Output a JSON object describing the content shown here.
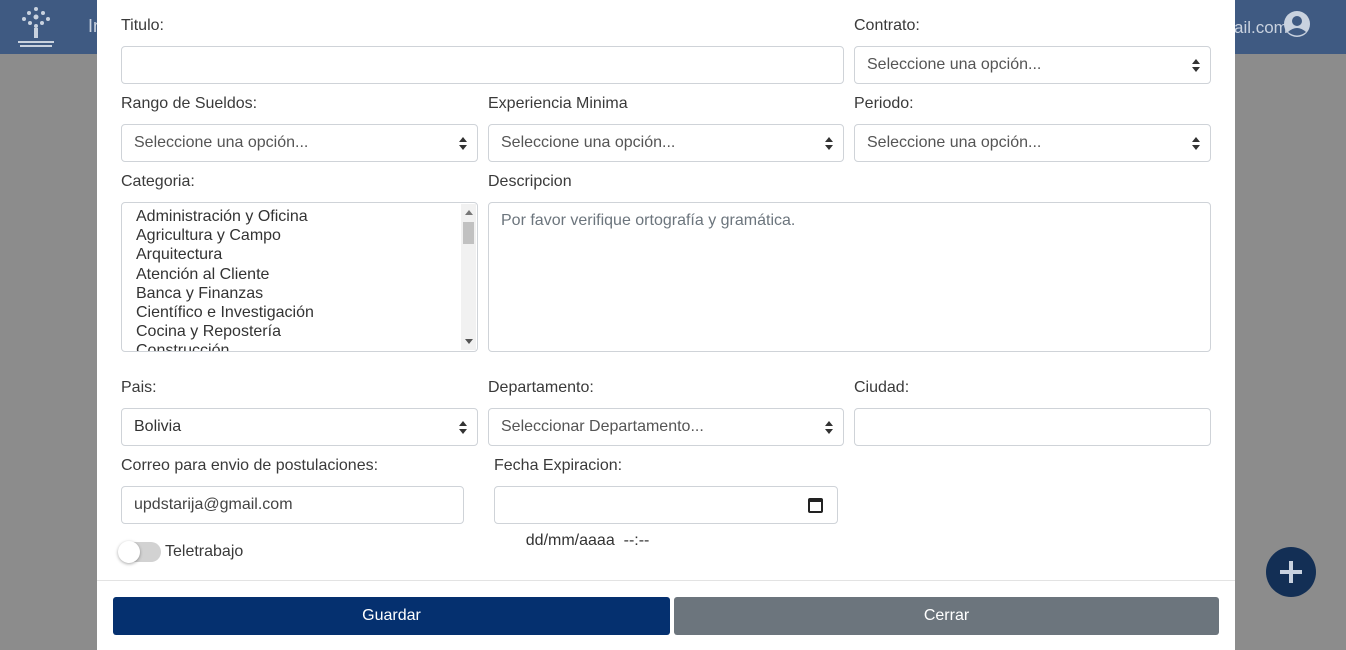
{
  "background": {
    "title_fragment": "In",
    "email_fragment": "ail.com"
  },
  "form": {
    "titulo": {
      "label": "Titulo:",
      "value": ""
    },
    "contrato": {
      "label": "Contrato:",
      "value": "Seleccione una opción..."
    },
    "rango_sueldos": {
      "label": "Rango de Sueldos:",
      "value": "Seleccione una opción..."
    },
    "experiencia": {
      "label": "Experiencia Minima",
      "value": "Seleccione una opción..."
    },
    "periodo": {
      "label": "Periodo:",
      "value": "Seleccione una opción..."
    },
    "categoria": {
      "label": "Categoria:",
      "options": [
        "Administración y Oficina",
        "Agricultura y Campo",
        "Arquitectura",
        "Atención al Cliente",
        "Banca y Finanzas",
        "Científico e Investigación",
        "Cocina y Repostería",
        "Construcción"
      ]
    },
    "descripcion": {
      "label": "Descripcion",
      "placeholder": "Por favor verifique ortografía y gramática."
    },
    "pais": {
      "label": "Pais:",
      "value": "Bolivia"
    },
    "departamento": {
      "label": "Departamento:",
      "value": "Seleccionar Departamento..."
    },
    "ciudad": {
      "label": "Ciudad:",
      "value": ""
    },
    "correo": {
      "label": "Correo para envio de postulaciones:",
      "value": "updstarija@gmail.com"
    },
    "fecha": {
      "label": "Fecha Expiracion:",
      "value": "dd/mm/aaaa  --:--"
    },
    "teletrabajo": {
      "label": "Teletrabajo",
      "checked": false
    }
  },
  "actions": {
    "save_label": "Guardar",
    "close_label": "Cerrar"
  },
  "colors": {
    "primary": "#05306f",
    "secondary": "#6c757d"
  }
}
